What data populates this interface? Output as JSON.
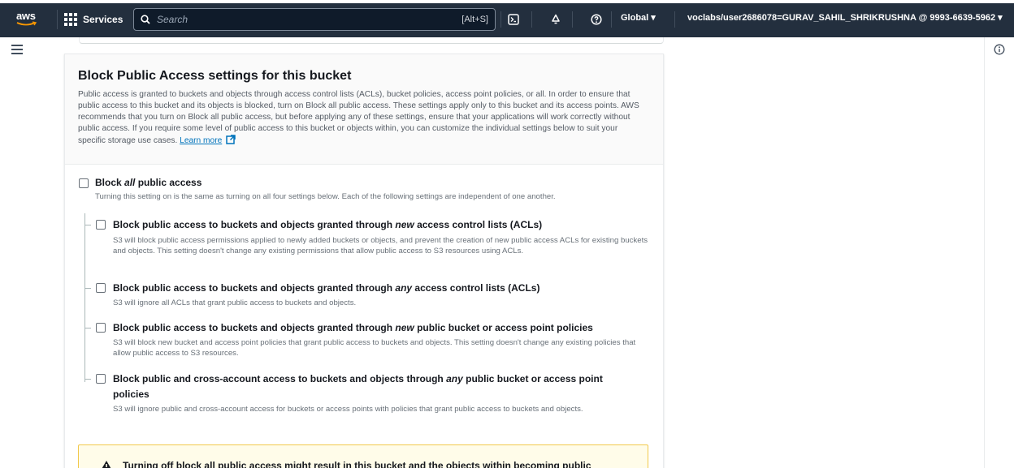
{
  "topnav": {
    "logo_text": "aws",
    "services_label": "Services",
    "search_placeholder": "Search",
    "search_shortcut": "[Alt+S]",
    "region_label": "Global ▾",
    "account_label": "voclabs/user2686078=GURAV_SAHIL_SHRIKRUSHNA @ 9993-6639-5962 ▾"
  },
  "icons": {
    "menu": "hamburger-menu-icon",
    "cloudshell": "cloudshell-terminal-icon",
    "notifications": "bell-icon",
    "help": "help-circle-icon",
    "info": "info-icon",
    "external": "external-link-icon",
    "warning": "warning-triangle-icon"
  },
  "colors": {
    "nav_bg": "#232f3e",
    "link": "#0073bb",
    "warning_border": "#f2c94c",
    "warning_bg": "#fffce9"
  },
  "block_public_access": {
    "title": "Block Public Access settings for this bucket",
    "description": "Public access is granted to buckets and objects through access control lists (ACLs), bucket policies, access point policies, or all. In order to ensure that public access to this bucket and its objects is blocked, turn on Block all public access. These settings apply only to this bucket and its access points. AWS recommends that you turn on Block all public access, but before applying any of these settings, ensure that your applications will work correctly without public access. If you require some level of public access to this bucket or objects within, you can customize the individual settings below to suit your specific storage use cases.",
    "learn_more": "Learn more",
    "block_all": {
      "title_prefix": "Block ",
      "title_em": "all",
      "title_suffix": " public access",
      "checked": false,
      "description": "Turning this setting on is the same as turning on all four settings below. Each of the following settings are independent of one another."
    },
    "options": [
      {
        "title_prefix": "Block public access to buckets and objects granted through ",
        "title_em": "new",
        "title_suffix": " access control lists (ACLs)",
        "checked": false,
        "description": "S3 will block public access permissions applied to newly added buckets or objects, and prevent the creation of new public access ACLs for existing buckets and objects. This setting doesn't change any existing permissions that allow public access to S3 resources using ACLs."
      },
      {
        "title_prefix": "Block public access to buckets and objects granted through ",
        "title_em": "any",
        "title_suffix": " access control lists (ACLs)",
        "checked": false,
        "description": "S3 will ignore all ACLs that grant public access to buckets and objects."
      },
      {
        "title_prefix": "Block public access to buckets and objects granted through ",
        "title_em": "new",
        "title_suffix": " public bucket or access point policies",
        "checked": false,
        "description": "S3 will block new bucket and access point policies that grant public access to buckets and objects. This setting doesn't change any existing policies that allow public access to S3 resources."
      },
      {
        "title_prefix": "Block public and cross-account access to buckets and objects through ",
        "title_em": "any",
        "title_suffix": " public bucket or access point",
        "title_line2": "policies",
        "checked": false,
        "description": "S3 will ignore public and cross-account access for buckets or access points with policies that grant public access to buckets and objects."
      }
    ],
    "warning_text": "Turning off block all public access might result in this bucket and the objects within becoming public"
  }
}
